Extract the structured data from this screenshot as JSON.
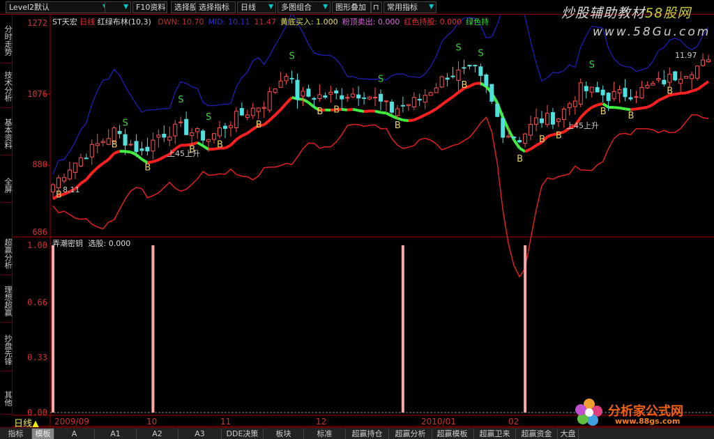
{
  "toolbar": {
    "items": [
      {
        "label": "Level2默认",
        "dd": true
      },
      {
        "label": "",
        "dd": true
      },
      {
        "label": "F10资料"
      },
      {
        "label": "选择股票"
      },
      {
        "label": "选择指标"
      },
      {
        "label": "日线",
        "dd": true
      },
      {
        "label": "多图组合",
        "dd": true
      },
      {
        "label": "图形叠加"
      },
      {
        "label": "常用指标",
        "dd": true
      }
    ],
    "lock_icon": "lock-icon"
  },
  "watermark": {
    "title": "炒股辅助教材",
    "brand": "58股网",
    "url": "www.58Gu.com"
  },
  "left_tabs": [
    "分时走势",
    "技术分析",
    "基本资料",
    "全屏",
    "超赢分析",
    "理想超赢",
    "抄盘先锋",
    "其他"
  ],
  "main_chart": {
    "stock": "ST天宏",
    "period": "日线",
    "indicator": "红绿布林(10,3)",
    "params": [
      {
        "label": "DWN: 10.70",
        "color": "#c03030"
      },
      {
        "label": "MID: 10.11",
        "color": "#3030c0"
      },
      {
        "label": "11.47",
        "color": "#c03030"
      },
      {
        "label": "黄底买入: 1.000",
        "color": "#e8e060"
      },
      {
        "label": "粉顶卖出: 0.000",
        "color": "#e060e0"
      },
      {
        "label": "红色持股: 0.000",
        "color": "#e03030"
      },
      {
        "label": "绿色持",
        "color": "#30e030"
      }
    ],
    "y_ticks": [
      "1272",
      "1076",
      "880",
      "686"
    ],
    "low_label": "8.11",
    "high_label": "11.97",
    "rise_label": "上45上升"
  },
  "sub_chart": {
    "title": "弄潮密钥",
    "value_label": "选股: 0.000",
    "y_ticks": [
      "1.00",
      "0.66",
      "0.33",
      "0.00"
    ]
  },
  "period_label": "日线",
  "dates": [
    "2009/09",
    "10",
    "11",
    "12",
    "2010/01",
    "02"
  ],
  "bottom_tabs": [
    "指标",
    "模板",
    "A",
    "A1",
    "A2",
    "A3",
    "DDE决策",
    "板块",
    "标准",
    "超赢持仓",
    "超赢分析",
    "超赢模板",
    "超赢卫来",
    "超赢资金",
    "大盘"
  ],
  "brand": {
    "name": "分析家公式网",
    "url": "www.88gs.com"
  },
  "chart_data": {
    "type": "candlestick",
    "y_range": [
      6.86,
      12.72
    ],
    "close_keypoints": [
      [
        0,
        8.2
      ],
      [
        3,
        8.7
      ],
      [
        7,
        9.2
      ],
      [
        11,
        9.7
      ],
      [
        16,
        9.1
      ],
      [
        19,
        9.6
      ],
      [
        23,
        9.8
      ],
      [
        28,
        9.5
      ],
      [
        33,
        10.1
      ],
      [
        38,
        10.5
      ],
      [
        42,
        11.4
      ],
      [
        44,
        10.7
      ],
      [
        49,
        10.7
      ],
      [
        56,
        10.8
      ],
      [
        61,
        10.3
      ],
      [
        66,
        10.6
      ],
      [
        71,
        11.3
      ],
      [
        76,
        11.4
      ],
      [
        78,
        10.9
      ],
      [
        81,
        9.7
      ],
      [
        84,
        9.5
      ],
      [
        87,
        10.0
      ],
      [
        91,
        10.1
      ],
      [
        95,
        10.9
      ],
      [
        100,
        10.7
      ],
      [
        105,
        10.8
      ],
      [
        111,
        11.2
      ],
      [
        117,
        11.6
      ]
    ],
    "buy_signals": [
      1,
      11,
      17,
      25,
      30,
      37,
      48,
      51,
      62,
      74,
      84,
      88,
      91,
      99,
      104,
      111
    ],
    "sell_signals": [
      13,
      23,
      28,
      43,
      59,
      73,
      77,
      97
    ],
    "sub_signals": [
      {
        "index": 0,
        "value": 1.0
      },
      {
        "index": 18,
        "value": 1.0
      },
      {
        "index": 63,
        "value": 1.0
      },
      {
        "index": 85,
        "value": 1.0
      }
    ]
  },
  "colors": {
    "up": "#ff5050",
    "down": "#50e0e0",
    "mid_up": "#ff2020",
    "mid_down": "#40ee40",
    "upper": "#2020c0",
    "lower": "#e02020",
    "signal": "#f8a8a8"
  }
}
